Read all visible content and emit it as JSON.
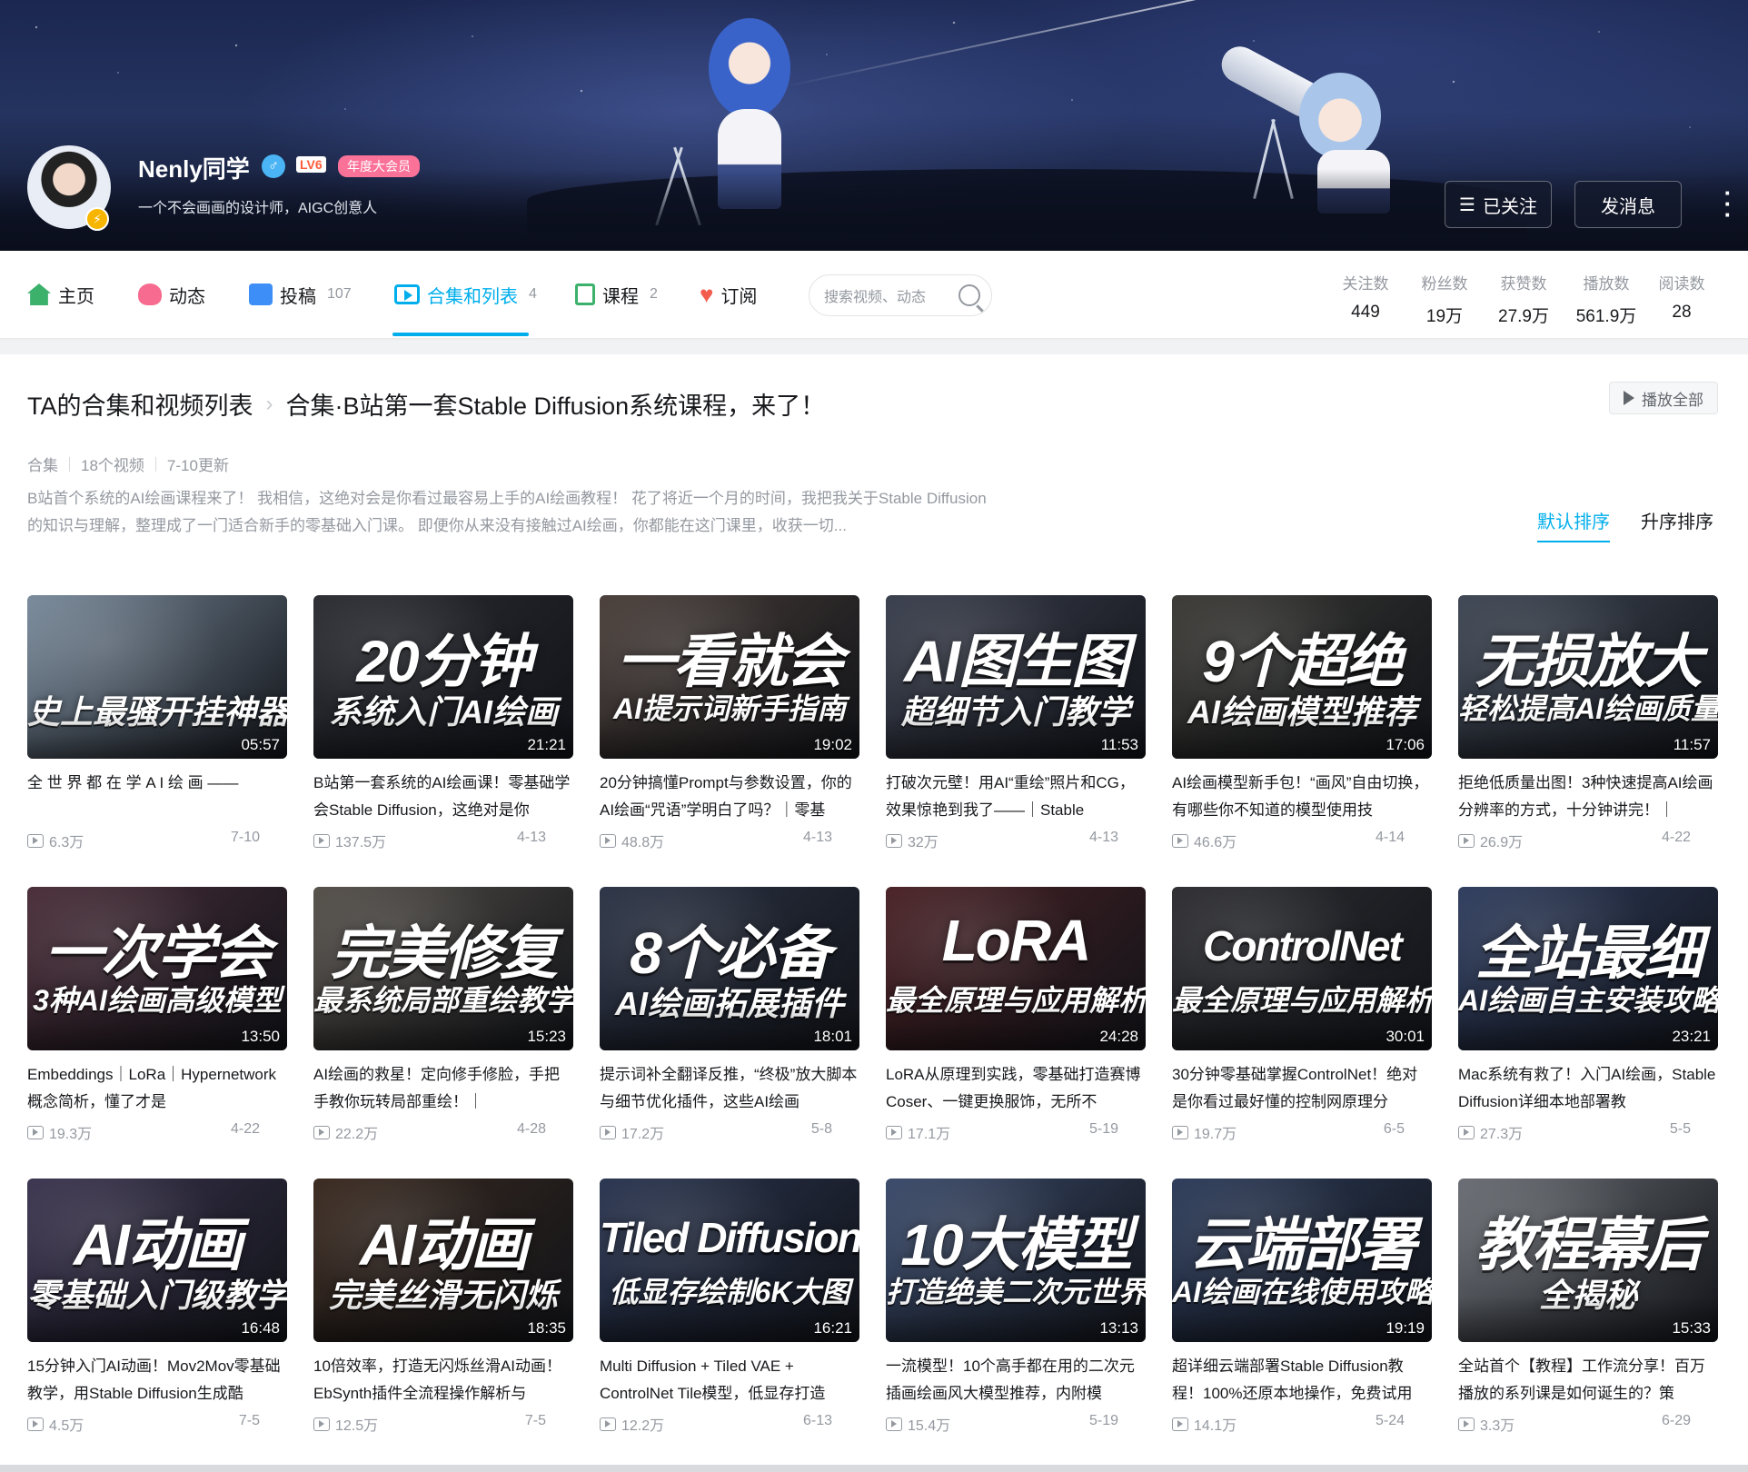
{
  "profile": {
    "name": "Nenly同学",
    "level": "LV6",
    "vip_label": "年度大会员",
    "sign": "一个不会画画的设计师，AIGC创意人",
    "follow_btn": "已关注",
    "message_btn": "发消息"
  },
  "nav": {
    "tabs": [
      {
        "label": "主页",
        "count": "",
        "icon": "home-icon"
      },
      {
        "label": "动态",
        "count": "",
        "icon": "dynamic-icon"
      },
      {
        "label": "投稿",
        "count": "107",
        "icon": "upload-icon"
      },
      {
        "label": "合集和列表",
        "count": "4",
        "icon": "collection-icon"
      },
      {
        "label": "课程",
        "count": "2",
        "icon": "course-icon"
      },
      {
        "label": "订阅",
        "count": "",
        "icon": "heart-icon"
      }
    ],
    "search_placeholder": "搜索视频、动态",
    "stats": [
      {
        "label": "关注数",
        "value": "449"
      },
      {
        "label": "粉丝数",
        "value": "19万"
      },
      {
        "label": "获赞数",
        "value": "27.9万"
      },
      {
        "label": "播放数",
        "value": "561.9万"
      },
      {
        "label": "阅读数",
        "value": "28"
      }
    ]
  },
  "collection": {
    "crumb_root": "TA的合集和视频列表",
    "crumb_title": "合集·B站第一套Stable Diffusion系统课程，来了！",
    "play_all": "播放全部",
    "meta_type": "合集",
    "meta_count": "18个视频",
    "meta_updated": "7-10更新",
    "description": "B站首个系统的AI绘画课程来了！ 我相信，这绝对会是你看过最容易上手的AI绘画教程！ 花了将近一个月的时间，我把我关于Stable Diffusion的知识与理解，整理成了一门适合新手的零基础入门课。 即便你从来没有接触过AI绘画，你都能在这门课里，收获一切...",
    "sort_default": "默认排序",
    "sort_asc": "升序排序"
  },
  "videos": [
    {
      "thumb_main": "",
      "thumb_sub": "史上最骚开挂神器",
      "duration": "05:57",
      "title": "全 世 界 都 在 学 A I 绘 画 ——",
      "views": "6.3万",
      "date": "7-10",
      "bg": "#7a8b9c"
    },
    {
      "thumb_main": "20分钟",
      "thumb_sub": "系统入门AI绘画",
      "duration": "21:21",
      "title": "B站第一套系统的AI绘画课！零基础学会Stable Diffusion，这绝对是你",
      "views": "137.5万",
      "date": "4-13",
      "bg": "#2b2d33"
    },
    {
      "thumb_main": "一看就会",
      "thumb_sub": "AI提示词新手指南",
      "duration": "19:02",
      "title": "20分钟搞懂Prompt与参数设置，你的AI绘画“咒语”学明白了吗？｜零基",
      "views": "48.8万",
      "date": "4-13",
      "bg": "#4a3f3a"
    },
    {
      "thumb_main": "AI图生图",
      "thumb_sub": "超细节入门教学",
      "duration": "11:53",
      "title": "打破次元壁！用AI“重绘”照片和CG，效果惊艳到我了——｜Stable",
      "views": "32万",
      "date": "4-13",
      "bg": "#3a3f4d"
    },
    {
      "thumb_main": "9个超绝",
      "thumb_sub": "AI绘画模型推荐",
      "duration": "17:06",
      "title": "AI绘画模型新手包！“画风”自由切换，有哪些你不知道的模型使用技",
      "views": "46.6万",
      "date": "4-14",
      "bg": "#3b3a36"
    },
    {
      "thumb_main": "无损放大",
      "thumb_sub": "轻松提高AI绘画质量",
      "duration": "11:57",
      "title": "拒绝低质量出图！3种快速提高AI绘画分辨率的方式，十分钟讲完！｜",
      "views": "26.9万",
      "date": "4-22",
      "bg": "#3f4754"
    },
    {
      "thumb_main": "一次学会",
      "thumb_sub": "3种AI绘画高级模型",
      "duration": "13:50",
      "title": "Embeddings｜LoRa｜Hypernetwork概念简析，懂了才是",
      "views": "19.3万",
      "date": "4-22",
      "bg": "#4a2e3a"
    },
    {
      "thumb_main": "完美修复",
      "thumb_sub": "最系统局部重绘教学",
      "duration": "15:23",
      "title": "AI绘画的救星！定向修手修脸，手把手教你玩转局部重绘！｜",
      "views": "22.2万",
      "date": "4-28",
      "bg": "#55504a"
    },
    {
      "thumb_main": "8个必备",
      "thumb_sub": "AI绘画拓展插件",
      "duration": "18:01",
      "title": "提示词补全翻译反推，“终极”放大脚本与细节优化插件，这些AI绘画",
      "views": "17.2万",
      "date": "5-8",
      "bg": "#2c3446"
    },
    {
      "thumb_main": "LoRA",
      "thumb_sub": "最全原理与应用解析",
      "duration": "24:28",
      "title": "LoRA从原理到实践，零基础打造赛博Coser、一键更换服饰，无所不",
      "views": "17.1万",
      "date": "5-19",
      "bg": "#4a2226"
    },
    {
      "thumb_main": "ControlNet",
      "thumb_sub": "最全原理与应用解析",
      "duration": "30:01",
      "title": "30分钟零基础掌握ControlNet！绝对是你看过最好懂的控制网原理分",
      "views": "19.7万",
      "date": "6-5",
      "bg": "#2e2e32"
    },
    {
      "thumb_main": "全站最细",
      "thumb_sub": "AI绘画自主安装攻略",
      "duration": "23:21",
      "title": "Mac系统有救了！入门AI绘画，Stable Diffusion详细本地部署教",
      "views": "27.3万",
      "date": "5-5",
      "bg": "#2f3d5e"
    },
    {
      "thumb_main": "AI动画",
      "thumb_sub": "零基础入门级教学",
      "duration": "16:48",
      "title": "15分钟入门AI动画！Mov2Mov零基础教学，用Stable Diffusion生成酷",
      "views": "4.5万",
      "date": "7-5",
      "bg": "#3c3550"
    },
    {
      "thumb_main": "AI动画",
      "thumb_sub": "完美丝滑无闪烁",
      "duration": "18:35",
      "title": "10倍效率，打造无闪烁丝滑AI动画！EbSynth插件全流程操作解析与",
      "views": "12.5万",
      "date": "7-5",
      "bg": "#3a2a20"
    },
    {
      "thumb_main": "Tiled Diffusion",
      "thumb_sub": "低显存绘制6K大图",
      "duration": "16:21",
      "title": "Multi Diffusion + Tiled VAE + ControlNet Tile模型，低显存打造",
      "views": "12.2万",
      "date": "6-13",
      "bg": "#2a3550"
    },
    {
      "thumb_main": "10大模型",
      "thumb_sub": "打造绝美二次元世界",
      "duration": "13:13",
      "title": "一流模型！10个高手都在用的二次元插画绘画风大模型推荐，内附模",
      "views": "15.4万",
      "date": "5-19",
      "bg": "#3a4a6a"
    },
    {
      "thumb_main": "云端部署",
      "thumb_sub": "AI绘画在线使用攻略",
      "duration": "19:19",
      "title": "超详细云端部署Stable Diffusion教程！100%还原本地操作，免费试用",
      "views": "14.1万",
      "date": "5-24",
      "bg": "#2d3c5a"
    },
    {
      "thumb_main": "教程幕后",
      "thumb_sub": "全揭秘",
      "duration": "15:33",
      "title": "全站首个【教程】工作流分享！百万播放的系列课是如何诞生的？策",
      "views": "3.3万",
      "date": "6-29",
      "bg": "#6a6e74"
    }
  ]
}
